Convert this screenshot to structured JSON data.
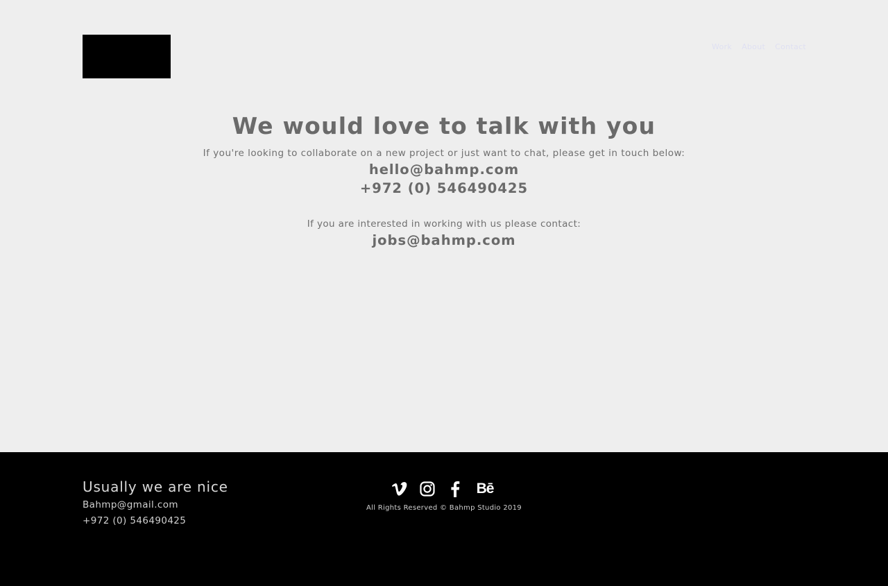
{
  "header": {
    "nav": [
      {
        "label": "Work"
      },
      {
        "label": "About"
      },
      {
        "label": "Contact"
      }
    ]
  },
  "main": {
    "heading": "We would love to talk with you",
    "intro": "If you're looking to collaborate on a new project or just want to chat, please get in touch below:",
    "email": "hello@bahmp.com",
    "phone": "+972 (0) 546490425",
    "jobs_intro": "If you are interested in working with us please contact:",
    "jobs_email": "jobs@bahmp.com"
  },
  "footer": {
    "tagline": "Usually we are nice",
    "email": "Bahmp@gmail.com",
    "phone": "+972 (0) 546490425",
    "social": [
      {
        "icon": "vimeo-icon"
      },
      {
        "icon": "instagram-icon"
      },
      {
        "icon": "facebook-icon"
      },
      {
        "icon": "behance-icon",
        "glyph": "Bē"
      }
    ],
    "copyright": "All Rights Reserved © Bahmp Studio 2019"
  },
  "colors": {
    "background": "#eeeeee",
    "text": "#6a6a6a",
    "footer_bg": "#000000",
    "nav_text": "#dfe0f2"
  }
}
